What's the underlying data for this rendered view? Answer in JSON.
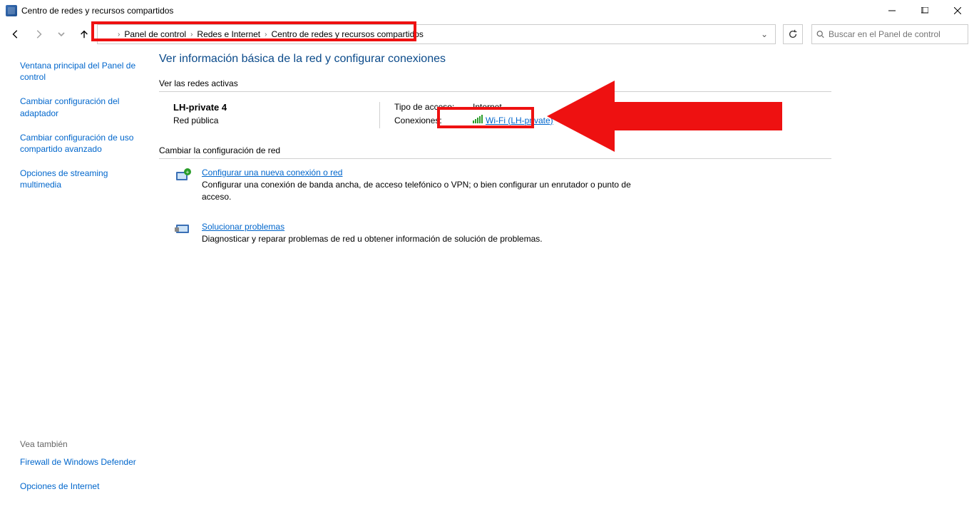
{
  "window": {
    "title": "Centro de redes y recursos compartidos"
  },
  "breadcrumb": {
    "items": [
      "Panel de control",
      "Redes e Internet",
      "Centro de redes y recursos compartidos"
    ]
  },
  "search": {
    "placeholder": "Buscar en el Panel de control"
  },
  "sidebar": {
    "links": [
      "Ventana principal del Panel de control",
      "Cambiar configuración del adaptador",
      "Cambiar configuración de uso compartido avanzado",
      "Opciones de streaming multimedia"
    ],
    "see_also_label": "Vea también",
    "see_also": [
      "Firewall de Windows Defender",
      "Opciones de Internet"
    ]
  },
  "content": {
    "heading": "Ver información básica de la red y configurar conexiones",
    "active_networks_label": "Ver las redes activas",
    "network": {
      "name": "LH-private 4",
      "type": "Red pública",
      "access_label": "Tipo de acceso:",
      "access_value": "Internet",
      "connections_label": "Conexiones:",
      "wifi_label": "Wi-Fi (LH-private)"
    },
    "change_label": "Cambiar la configuración de red",
    "options": [
      {
        "title": "Configurar una nueva conexión o red",
        "desc": "Configurar una conexión de banda ancha, de acceso telefónico o VPN; o bien configurar un enrutador o punto de acceso."
      },
      {
        "title": "Solucionar problemas",
        "desc": "Diagnosticar y reparar problemas de red u obtener información de solución de problemas."
      }
    ]
  }
}
